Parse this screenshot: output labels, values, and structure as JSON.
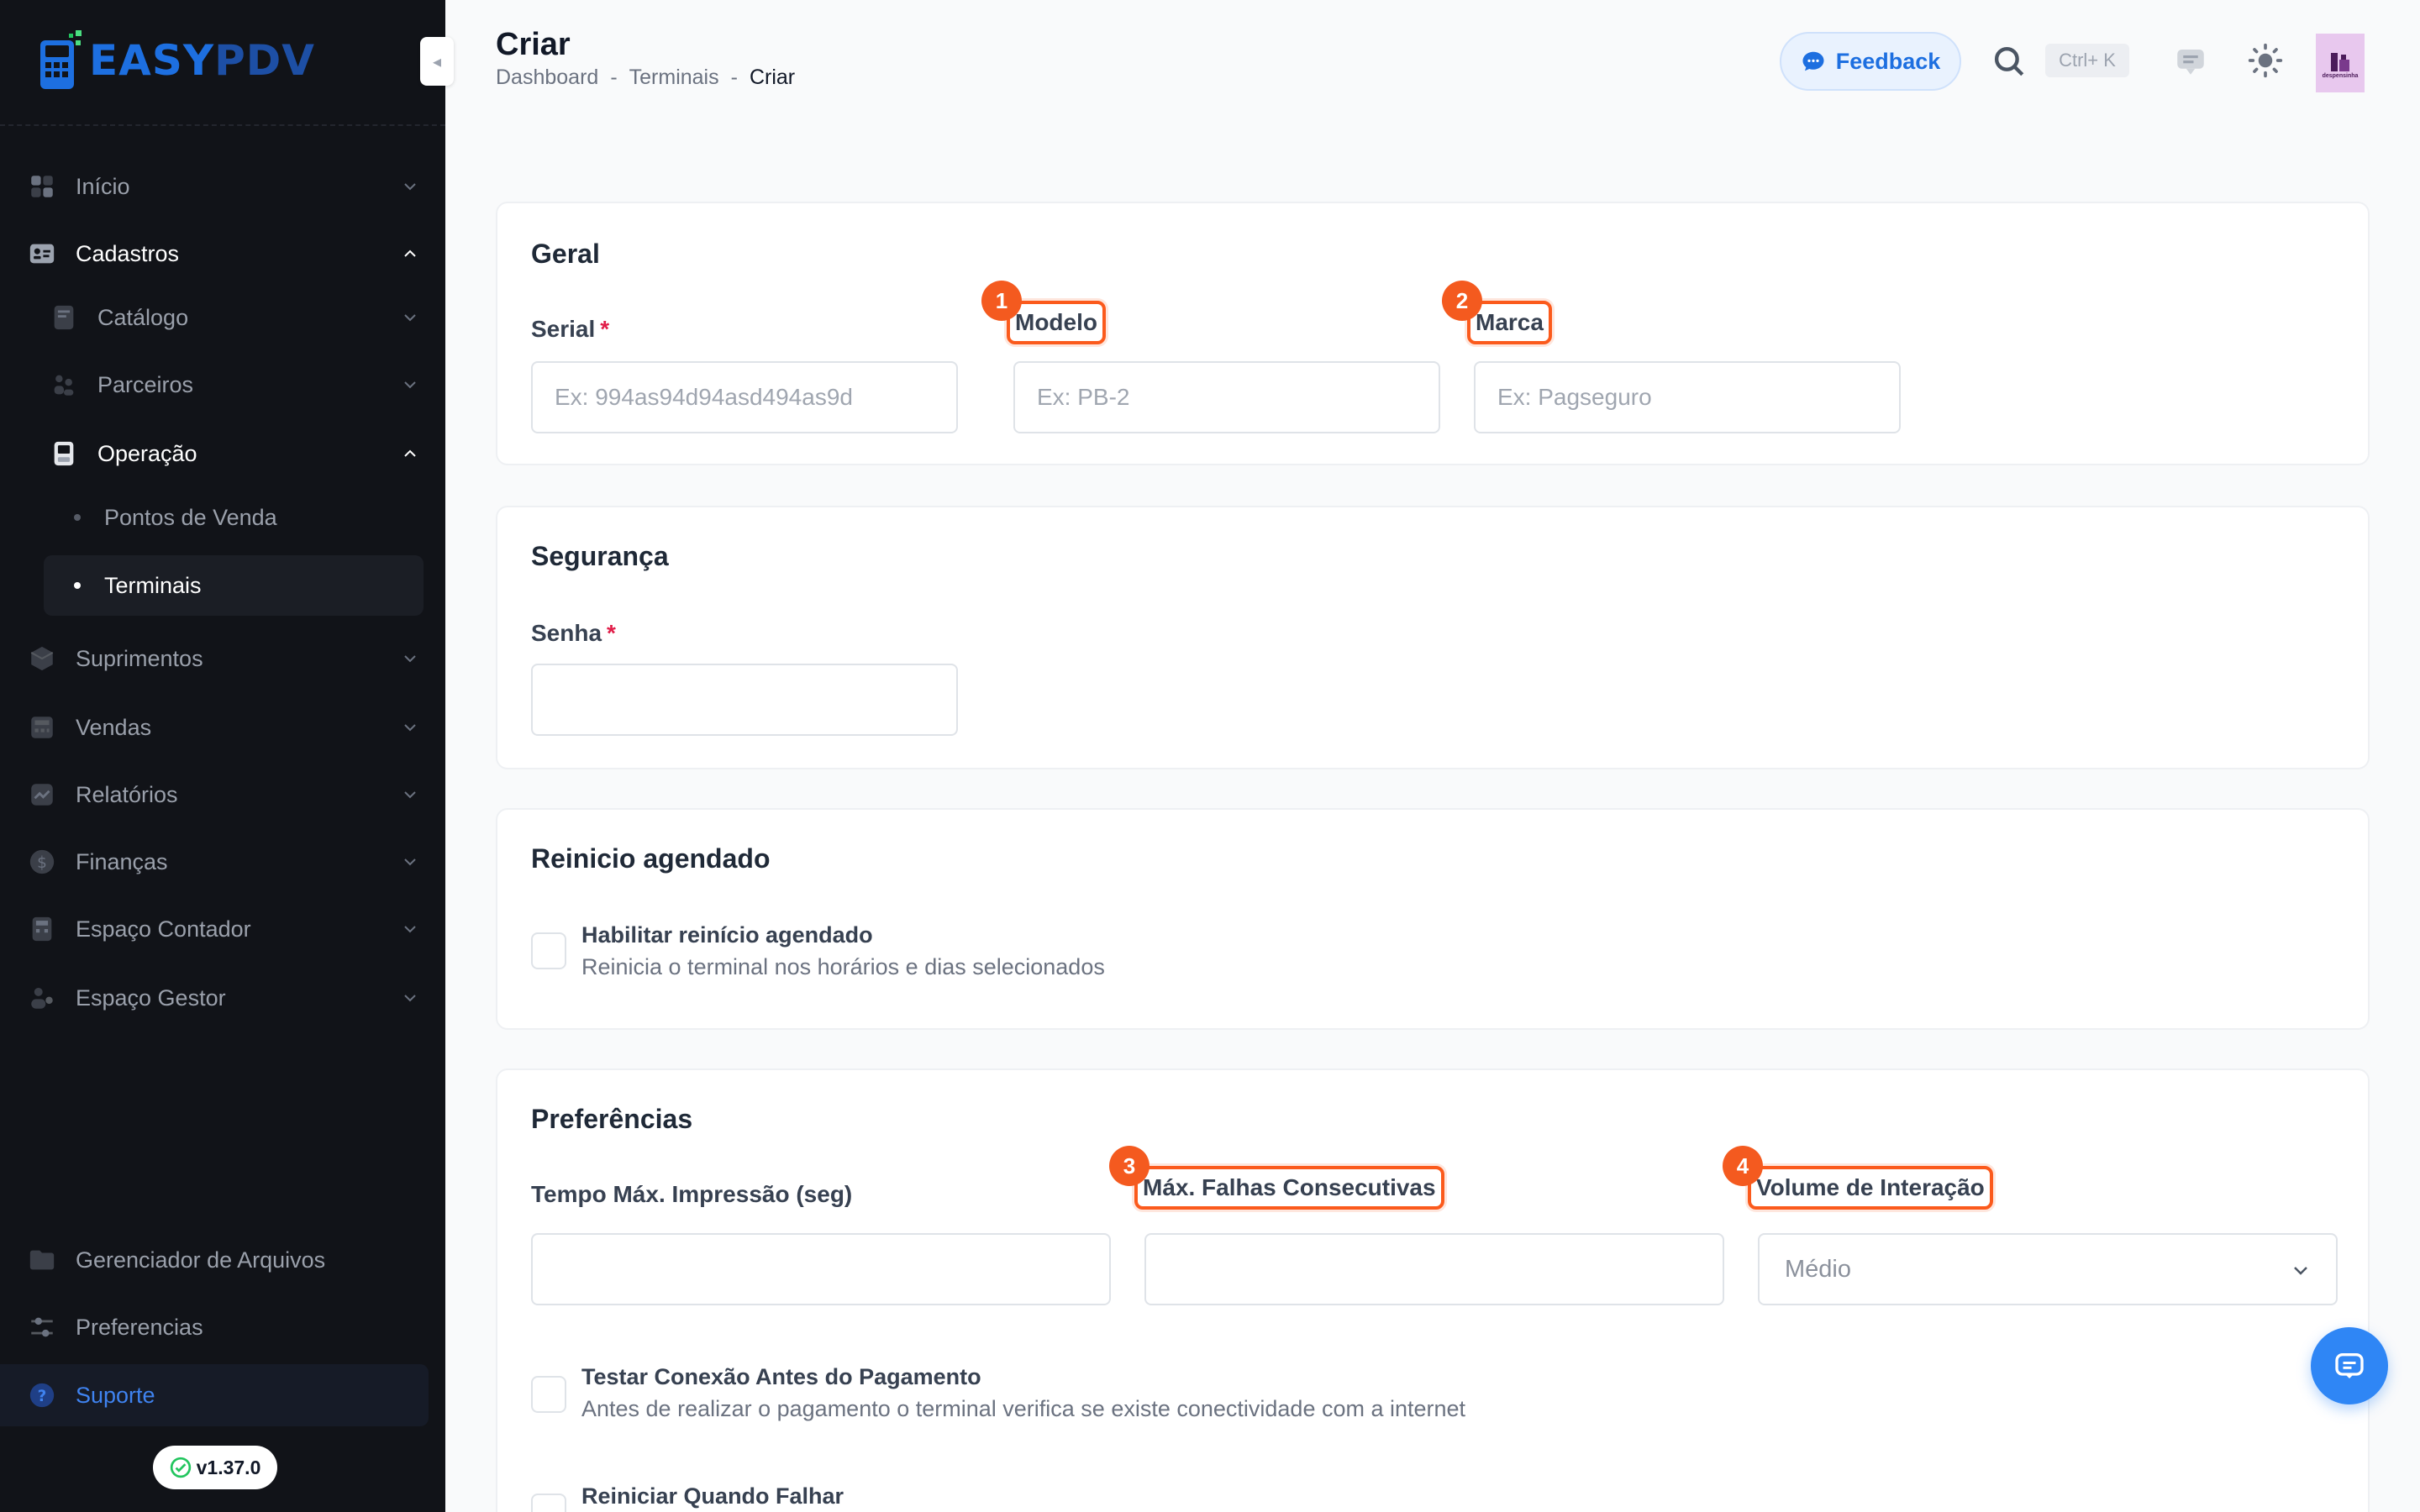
{
  "app": {
    "logo_easy": "EASY",
    "logo_pdv": "PDV",
    "version": "v1.37.0"
  },
  "sidebar": {
    "items": [
      {
        "label": "Início",
        "icon": "dashboard-icon"
      },
      {
        "label": "Cadastros",
        "icon": "id-card-icon"
      },
      {
        "label": "Catálogo",
        "icon": "catalog-icon"
      },
      {
        "label": "Parceiros",
        "icon": "partners-icon"
      },
      {
        "label": "Operação",
        "icon": "terminal-icon"
      },
      {
        "label": "Pontos de Venda"
      },
      {
        "label": "Terminais"
      },
      {
        "label": "Suprimentos",
        "icon": "box-icon"
      },
      {
        "label": "Vendas",
        "icon": "register-icon"
      },
      {
        "label": "Relatórios",
        "icon": "chart-icon"
      },
      {
        "label": "Finanças",
        "icon": "dollar-icon"
      },
      {
        "label": "Espaço Contador",
        "icon": "calculator-icon"
      },
      {
        "label": "Espaço Gestor",
        "icon": "manager-icon"
      }
    ],
    "bottom": [
      {
        "label": "Gerenciador de Arquivos",
        "icon": "folder-icon"
      },
      {
        "label": "Preferencias",
        "icon": "sliders-icon"
      },
      {
        "label": "Suporte",
        "icon": "help-icon"
      }
    ]
  },
  "header": {
    "title": "Criar",
    "breadcrumb": [
      "Dashboard",
      "-",
      "Terminais",
      "-",
      "Criar"
    ],
    "feedback_label": "Feedback",
    "shortcut": "Ctrl+ K",
    "avatar_text": "despensinha"
  },
  "sections": {
    "geral": {
      "title": "Geral",
      "serial_label": "Serial",
      "serial_placeholder": "Ex: 994as94d94asd494as9d",
      "modelo_label": "Modelo",
      "modelo_placeholder": "Ex: PB-2",
      "marca_label": "Marca",
      "marca_placeholder": "Ex: Pagseguro"
    },
    "seguranca": {
      "title": "Segurança",
      "senha_label": "Senha"
    },
    "reinicio": {
      "title": "Reinicio agendado",
      "check_title": "Habilitar reinício agendado",
      "check_desc": "Reinicia o terminal nos horários e dias selecionados"
    },
    "preferencias": {
      "title": "Preferências",
      "tempo_label": "Tempo Máx. Impressão (seg)",
      "falhas_label": "Máx. Falhas Consecutivas",
      "volume_label": "Volume de Interação",
      "volume_value": "Médio",
      "testar_title": "Testar Conexão Antes do Pagamento",
      "testar_desc": "Antes de realizar o pagamento o terminal verifica se existe conectividade com a internet",
      "reiniciar_title": "Reiniciar Quando Falhar"
    }
  },
  "annotations": [
    "1",
    "2",
    "3",
    "4"
  ],
  "colors": {
    "sidebar_bg": "#111318",
    "accent": "#1d6fe0",
    "highlight": "#fb5a1c",
    "required": "#e11d48"
  }
}
